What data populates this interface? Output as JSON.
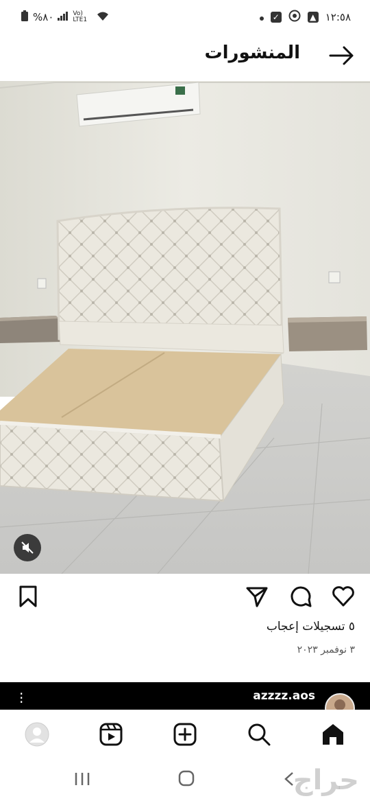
{
  "status_bar": {
    "time": "١٢:٥٨",
    "battery": "%٨٠",
    "network": "Vo) LTE1"
  },
  "header": {
    "title": "المنشورات"
  },
  "post": {
    "likes": "٥ تسجيلات إعجاب",
    "date": "٣ نوفمبر ٢٠٢٣"
  },
  "next_post": {
    "username": "azzzz.aos"
  },
  "watermark": {
    "text": "حراج"
  },
  "icons": {
    "header": "back-arrow-icon",
    "post_actions": [
      "heart-icon",
      "comment-icon",
      "share-icon",
      "bookmark-icon"
    ],
    "tabs": [
      "home-icon",
      "search-icon",
      "create-icon",
      "reels-icon",
      "profile-icon"
    ]
  }
}
